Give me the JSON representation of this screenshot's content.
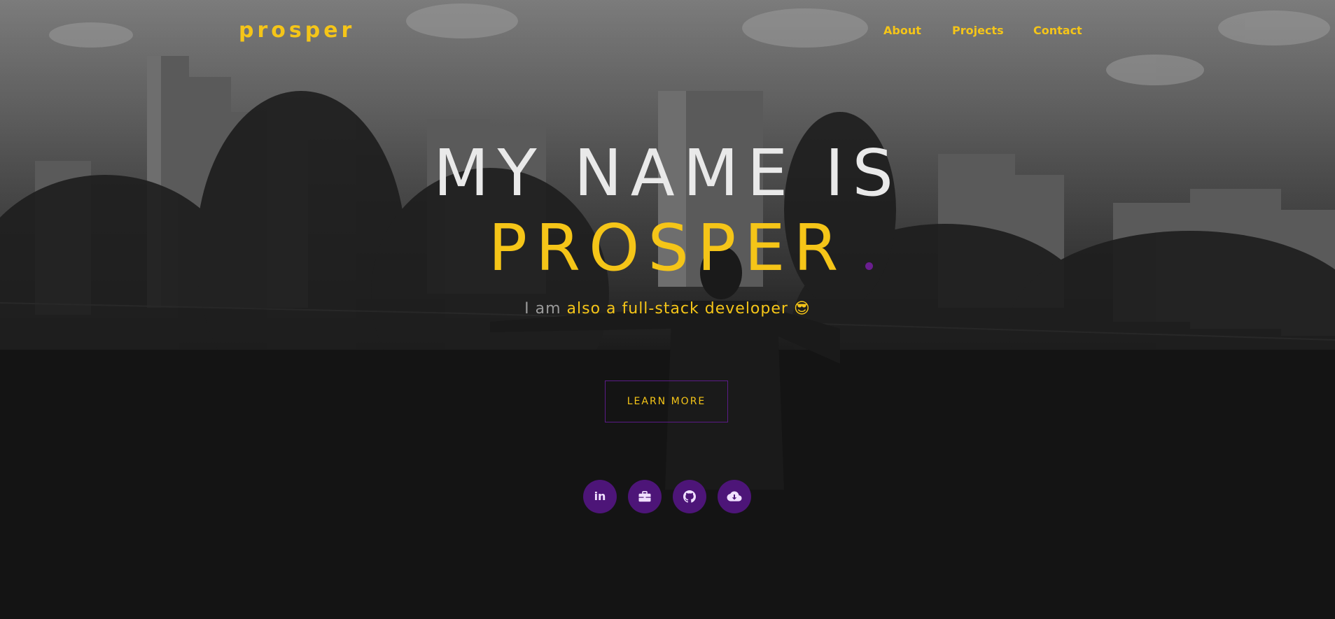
{
  "nav": {
    "logo": "prosper",
    "links": [
      "About",
      "Projects",
      "Contact"
    ]
  },
  "hero": {
    "line1": "MY NAME IS",
    "line2": "PROSPER",
    "tagline_dim": "I am",
    "tagline_rest": " also a full-stack developer 😎",
    "button_label": "LEARN MORE"
  },
  "social": {
    "linkedin_text": "in",
    "icons": [
      "linkedin-icon",
      "briefcase-icon",
      "github-icon",
      "cloud-download-icon"
    ]
  },
  "colors": {
    "accent": "#f5c518",
    "purple": "#4d1578",
    "headline": "#e9e9e9"
  }
}
